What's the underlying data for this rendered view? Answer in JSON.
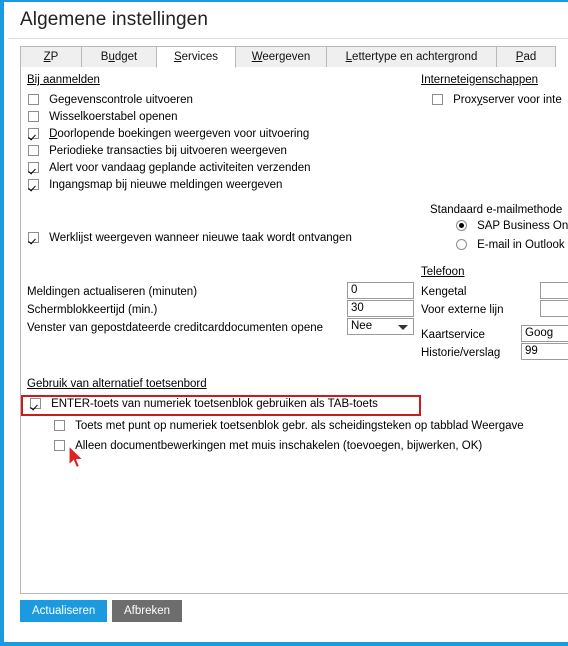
{
  "window": {
    "title": "Algemene instellingen",
    "accent_color": "#1b9ae0",
    "highlight_color": "#cc1b1b"
  },
  "tabs": [
    {
      "label": "ZP",
      "accel": "Z",
      "active": false
    },
    {
      "label": "Budget",
      "accel": "u",
      "active": false
    },
    {
      "label": "Services",
      "accel": "S",
      "active": true
    },
    {
      "label": "Weergeven",
      "accel": "W",
      "active": false
    },
    {
      "label": "Lettertype en achtergrond",
      "accel": "L",
      "active": false
    },
    {
      "label": "Pad",
      "accel": "P",
      "active": false
    }
  ],
  "left_column": {
    "login_group": {
      "heading": "Bij aanmelden",
      "checkboxes": [
        {
          "label": "Gegevenscontrole uitvoeren",
          "checked": false
        },
        {
          "label": "Wisselkoerstabel openen",
          "checked": false
        },
        {
          "label": "Doorlopende boekingen weergeven voor uitvoering",
          "checked": true,
          "accel": "D"
        },
        {
          "label": "Periodieke transacties bij uitvoeren weergeven",
          "checked": false
        },
        {
          "label": "Alert voor vandaag geplande activiteiten verzenden",
          "checked": true
        },
        {
          "label": "Ingangsmap bij nieuwe meldingen weergeven",
          "checked": true
        }
      ],
      "worklist_checkbox": {
        "label": "Werklijst weergeven wanneer nieuwe taak wordt ontvangen",
        "checked": true
      }
    },
    "fields": [
      {
        "label": "Meldingen actualiseren (minuten)",
        "value": "0",
        "type": "text"
      },
      {
        "label": "Schermblokkeertijd (min.)",
        "value": "30",
        "type": "text"
      },
      {
        "label": "Venster van gepostdateerde creditcarddocumenten opene",
        "value": "Nee",
        "type": "combo"
      }
    ]
  },
  "right_column": {
    "internet_group": {
      "heading": "Interneteigenschappen",
      "checkbox": {
        "label": "Proxyserver voor inte",
        "checked": false,
        "accel": "y"
      }
    },
    "email_group": {
      "heading": "Standaard e-mailmethode",
      "options": [
        {
          "label": "SAP Business One",
          "selected": true
        },
        {
          "label": "E-mail in Outlook",
          "selected": false
        }
      ]
    },
    "phone_group": {
      "heading": "Telefoon",
      "fields": [
        {
          "label": "Kengetal",
          "value": ""
        },
        {
          "label": "Voor externe lijn",
          "value": ""
        },
        {
          "label": "Kaartservice",
          "value": "Goog"
        },
        {
          "label": "Historie/verslag",
          "value": "99"
        }
      ]
    }
  },
  "keyboard_group": {
    "heading": "Gebruik van alternatief toetsenbord",
    "checkboxes": [
      {
        "label": "ENTER-toets van numeriek toetsenblok gebruiken als TAB-toets",
        "checked": true,
        "highlighted": true
      },
      {
        "label": "Toets met punt op numeriek toetsenblok gebr. als scheidingsteken op tabblad Weergave",
        "checked": false,
        "highlighted": false
      },
      {
        "label": "Alleen documentbewerkingen met muis inschakelen (toevoegen, bijwerken, OK)",
        "checked": false,
        "highlighted": false
      }
    ]
  },
  "buttons": {
    "update": "Actualiseren",
    "cancel": "Afbreken"
  }
}
